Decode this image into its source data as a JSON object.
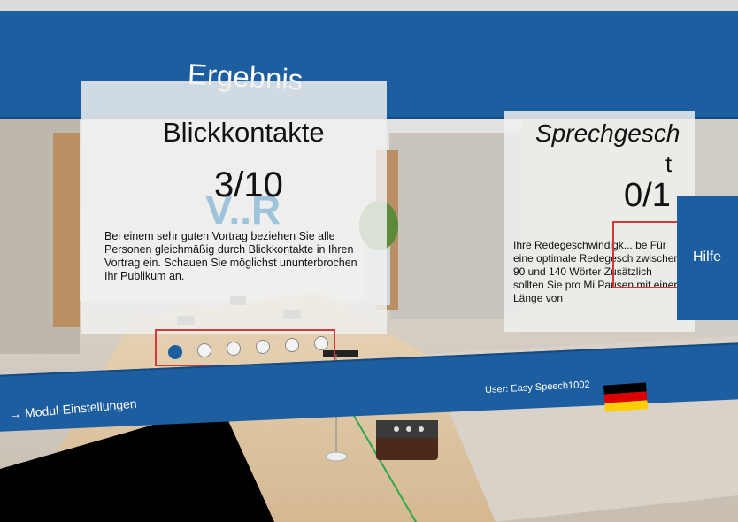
{
  "header": {
    "title": "Ergebnis"
  },
  "panel_eye_contact": {
    "title": "Blickkontakte",
    "score": "3/10",
    "logo_text": "V..R",
    "description": "Bei einem sehr guten Vortrag beziehen Sie alle Personen gleichmäßig durch Blickkontakte in Ihren Vortrag ein. Schauen Sie möglichst ununterbrochen Ihr Publikum an."
  },
  "panel_speech_rate": {
    "title": "Sprechgesch",
    "title_line2": "t",
    "score": "0/1",
    "description": "Ihre Redegeschwindigk... be Für eine optimale Redegesch zwischen 90 und 140 Wörter Zusätzlich sollten Sie pro Mi Pausen mit einer Länge von"
  },
  "help_button": {
    "label": "Hilfe"
  },
  "footer": {
    "module_settings": "→ Modul-Einstellungen",
    "user_label": "User: Easy Speech1002"
  },
  "pagination": {
    "count": 6,
    "active_index": 0
  },
  "colors": {
    "banner_blue": "#1d5ea0",
    "highlight_red": "#d23a3a",
    "flag_black": "#000000",
    "flag_red": "#dd0000",
    "flag_gold": "#ffce00"
  }
}
